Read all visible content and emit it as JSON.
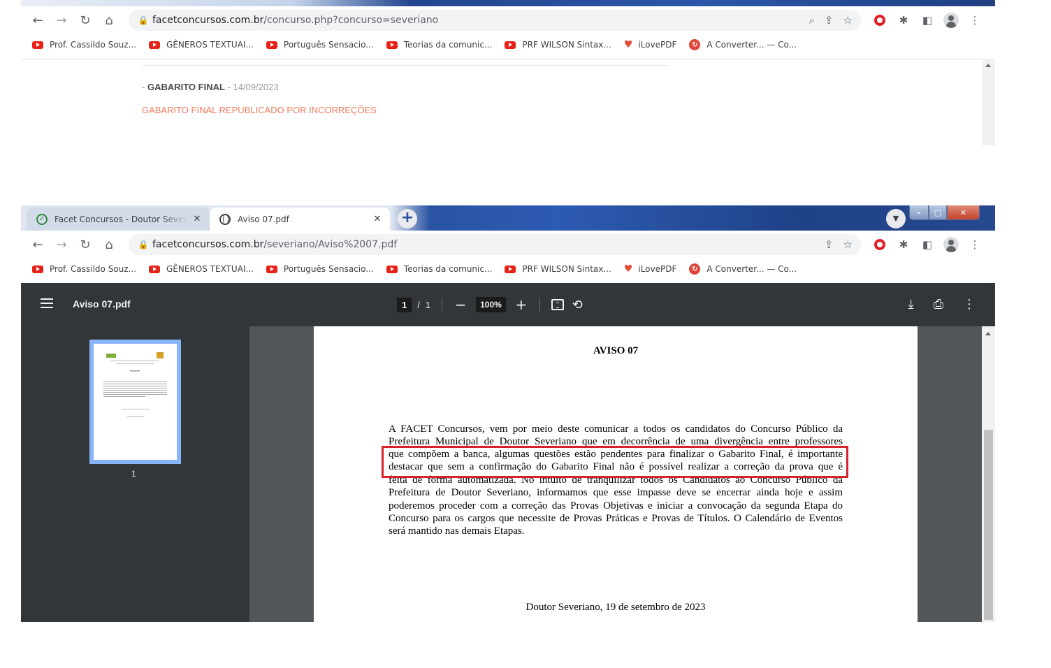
{
  "top_window": {
    "omnibox": {
      "url_host": "facetconcursos.com.br",
      "url_path": "/concurso.php?concurso=severiano"
    },
    "bookmarks": [
      {
        "label": "Prof. Cassildo Souz...",
        "icon": "youtube-icon"
      },
      {
        "label": "GÊNEROS TEXTUAI...",
        "icon": "youtube-icon"
      },
      {
        "label": "Português Sensacio...",
        "icon": "youtube-icon"
      },
      {
        "label": "Teorias da comunic...",
        "icon": "youtube-icon"
      },
      {
        "label": "PRF WILSON Sintax...",
        "icon": "youtube-icon"
      },
      {
        "label": "iLovePDF",
        "icon": "heart-icon"
      },
      {
        "label": "A Converter... — Co...",
        "icon": "converter-icon"
      }
    ],
    "page": {
      "gabarito_prefix": "- ",
      "gabarito_title": "GABARITO FINAL",
      "gabarito_date": " - 14/09/2023",
      "gabarito_link": "GABARITO FINAL REPUBLICADO POR INCORREÇÕES"
    }
  },
  "bottom_window": {
    "tabs": [
      {
        "title": "Facet Concursos - Doutor Severiano",
        "active": false
      },
      {
        "title": "Aviso 07.pdf",
        "active": true
      }
    ],
    "omnibox": {
      "url_host": "facetconcursos.com.br",
      "url_path": "/severiano/Aviso%2007.pdf"
    },
    "pdf": {
      "filename": "Aviso 07.pdf",
      "current_page": "1",
      "page_separator": "/",
      "total_pages": "1",
      "zoom": "100%",
      "thumbnail_label": "1",
      "document": {
        "title": "AVISO 07",
        "lines": [
          "A FACET Concursos, vem por meio deste comunicar a todos os candidatos do Concurso Público da",
          "Prefeitura Municipal de Doutor Severiano que em decorrência de uma divergência entre professores",
          "que compõem a banca, algumas questões estão pendentes para finalizar o Gabarito Final, é importante",
          "destacar que sem a confirmação do Gabarito Final não é possível realizar a correção da prova que é",
          "feita de forma automatizada. No intuito de tranquilizar todos os Candidatos ao Concurso Público da",
          "Prefeitura de Doutor Severiano, informamos que esse impasse deve se encerrar ainda hoje e assim",
          "poderemos proceder com a correção das Provas Objetivas e iniciar a convocação da segunda Etapa do",
          "Concurso para os cargos que necessite de Provas Práticas e Provas de Títulos. O Calendário de Eventos",
          "será mantido nas demais Etapas."
        ],
        "date_line": "Doutor Severiano, 19 de setembro de 2023"
      }
    }
  }
}
